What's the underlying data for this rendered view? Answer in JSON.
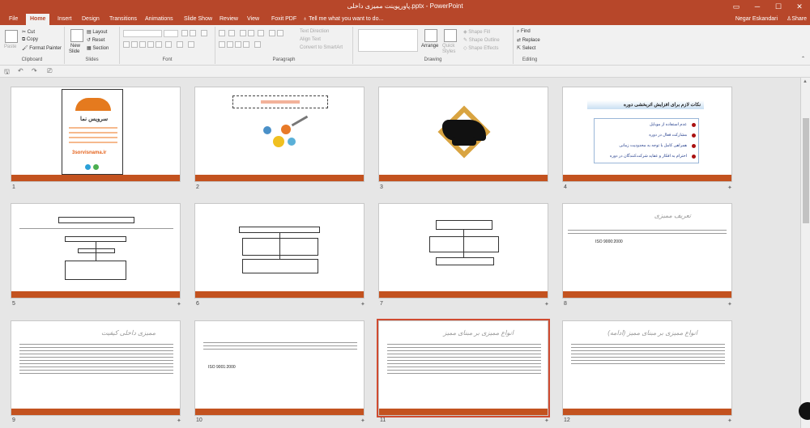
{
  "window": {
    "title": "پاورپوینت ممیزی داخلی.pptx - PowerPoint"
  },
  "tabs": [
    "File",
    "Home",
    "Insert",
    "Design",
    "Transitions",
    "Animations",
    "Slide Show",
    "Review",
    "View",
    "Foxit PDF"
  ],
  "tellme": "Tell me what you want to do...",
  "user": "Negar Eskandari",
  "share": "Share",
  "clipboard": {
    "paste": "Paste",
    "cut": "Cut",
    "copy": "Copy",
    "format_painter": "Format Painter",
    "label": "Clipboard"
  },
  "slides_group": {
    "new_slide": "New",
    "new_slide2": "Slide",
    "layout": "Layout",
    "reset": "Reset",
    "section": "Section",
    "label": "Slides"
  },
  "font_group": {
    "label": "Font"
  },
  "paragraph_group": {
    "text_direction": "Text Direction",
    "align_text": "Align Text",
    "convert_smartart": "Convert to SmartArt",
    "label": "Paragraph"
  },
  "drawing_group": {
    "arrange": "Arrange",
    "quick_styles": "Quick",
    "quick_styles2": "Styles",
    "shape_fill": "Shape Fill",
    "shape_outline": "Shape Outline",
    "shape_effects": "Shape Effects",
    "label": "Drawing"
  },
  "editing_group": {
    "find": "Find",
    "replace": "Replace",
    "select": "Select",
    "label": "Editing"
  },
  "slide_numbers": [
    "1",
    "2",
    "3",
    "4",
    "5",
    "6",
    "7",
    "8",
    "9",
    "10",
    "11",
    "12"
  ],
  "slide1": {
    "site": "سرویس نما",
    "url": "3sorvisnama.ir"
  },
  "slide4": {
    "heading": "نکات لازم برای افزایش اثربخشی دوره",
    "items": [
      "عدم استفاده از موبایل",
      "مشارکت فعال در دوره",
      "همراهی کامل با توجه به محدودیت زمانی",
      "احترام به افکار و عقاید شرکت‌کنندگان در دوره"
    ]
  },
  "slide8": {
    "heading": "تعریف ممیزی",
    "code": "ISO 9000:2000"
  },
  "slide9": {
    "heading": "ممیزی داخلی کیفیت"
  },
  "slide10": {
    "code": "ISO 9001:2000"
  },
  "slide11": {
    "heading": "انواع ممیزی بر مبنای ممیز"
  },
  "slide12": {
    "heading": "انواع ممیزی بر مبنای ممیز (ادامه)"
  }
}
